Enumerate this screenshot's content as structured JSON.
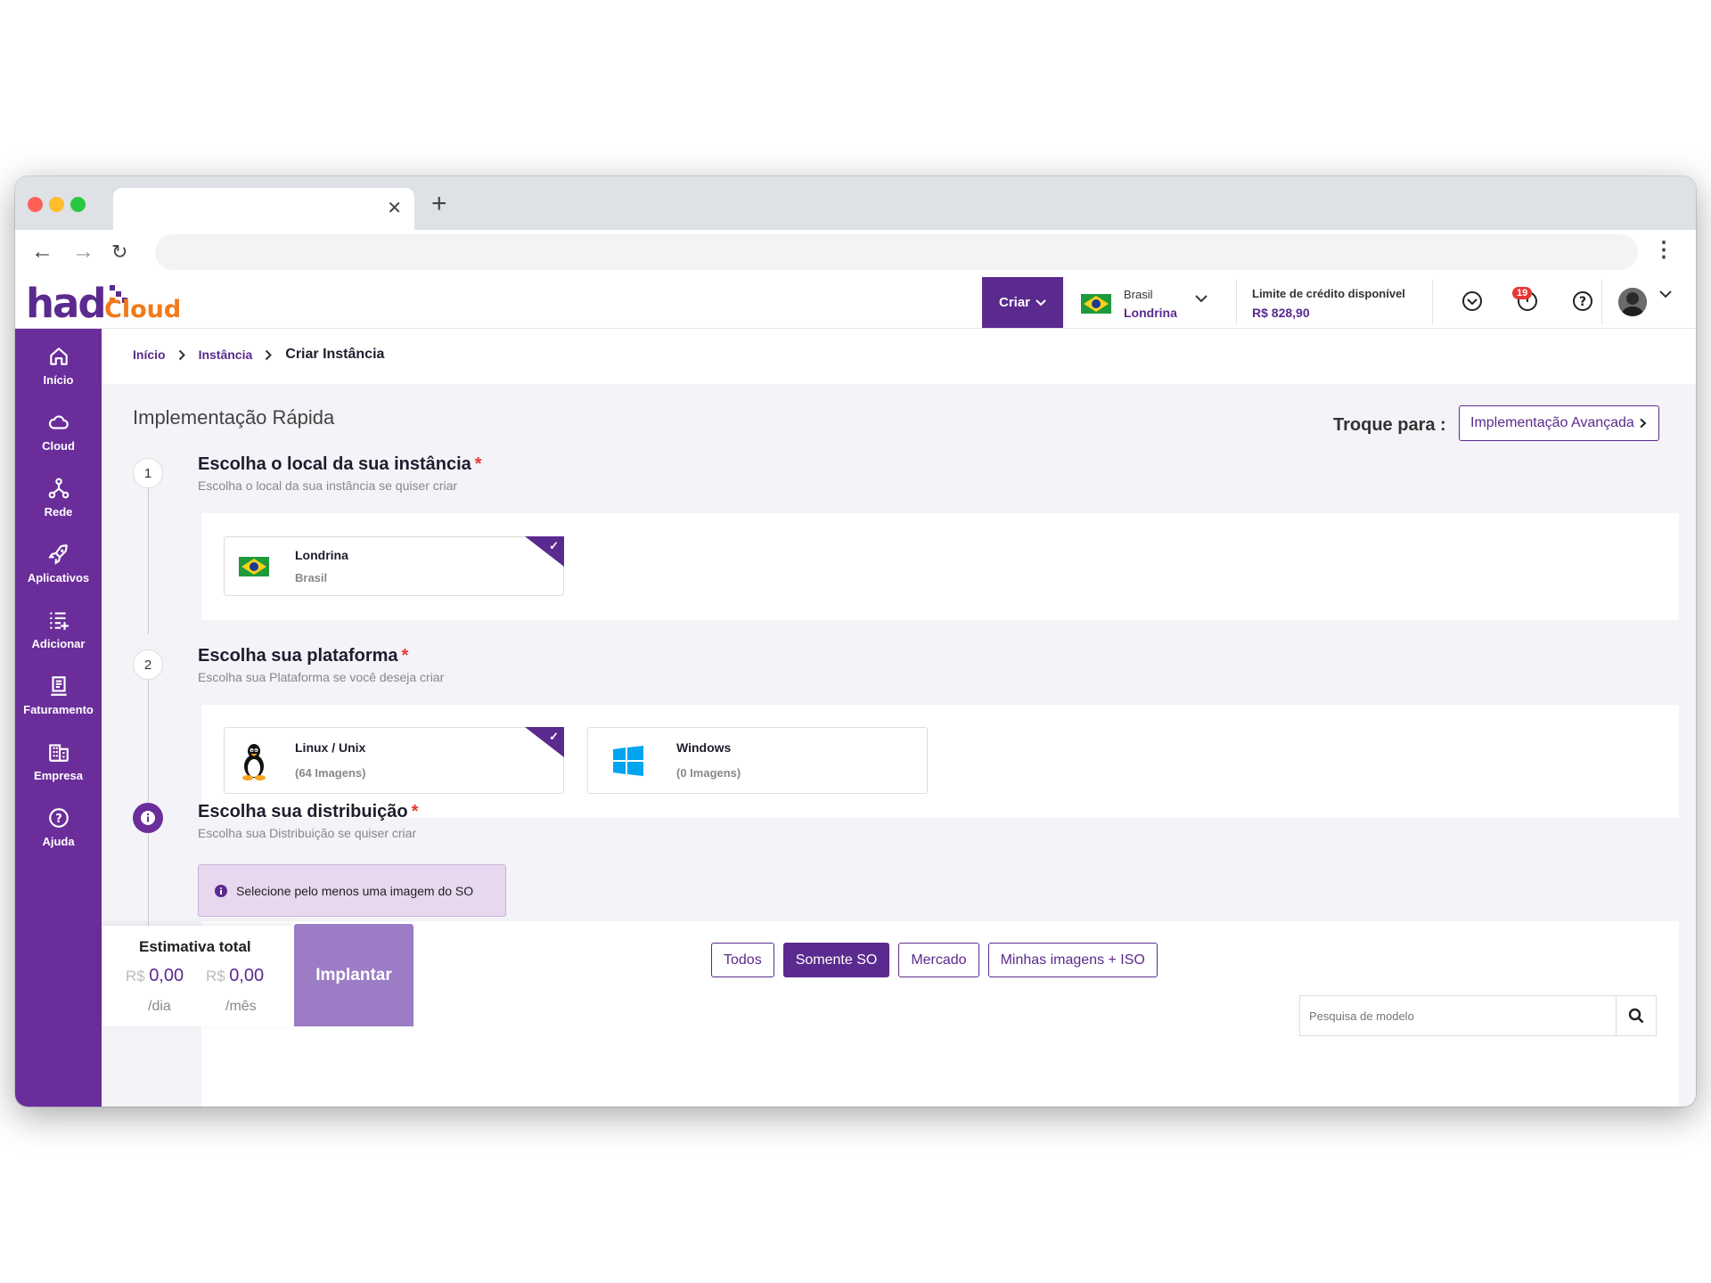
{
  "browser": {
    "tab_title": "",
    "url": ""
  },
  "header": {
    "logo_primary": "had",
    "logo_secondary": "Cloud",
    "create_label": "Criar",
    "region": {
      "country": "Brasil",
      "city": "Londrina"
    },
    "credit": {
      "label": "Limite de crédito disponível",
      "value": "R$ 828,90"
    },
    "notifications_count": "19"
  },
  "sidebar": {
    "items": [
      {
        "label": "Início",
        "icon": "home-icon"
      },
      {
        "label": "Cloud",
        "icon": "cloud-icon"
      },
      {
        "label": "Rede",
        "icon": "network-icon"
      },
      {
        "label": "Aplicativos",
        "icon": "rocket-icon"
      },
      {
        "label": "Adicionar",
        "icon": "add-list-icon"
      },
      {
        "label": "Faturamento",
        "icon": "invoice-icon"
      },
      {
        "label": "Empresa",
        "icon": "building-icon"
      },
      {
        "label": "Ajuda",
        "icon": "help-icon"
      }
    ]
  },
  "breadcrumb": {
    "items": [
      "Início",
      "Instância"
    ],
    "current": "Criar Instância"
  },
  "page": {
    "title": "Implementação Rápida",
    "switch_label": "Troque para :",
    "switch_button": "Implementação Avançada"
  },
  "steps": [
    {
      "number": "1",
      "title": "Escolha o local da sua instância",
      "subtitle": "Escolha o local da sua instância se quiser criar",
      "options": [
        {
          "title": "Londrina",
          "subtitle": "Brasil",
          "selected": true
        }
      ]
    },
    {
      "number": "2",
      "title": "Escolha sua plataforma",
      "subtitle": "Escolha sua Plataforma se você deseja criar",
      "options": [
        {
          "title": "Linux / Unix",
          "subtitle": "(64 Imagens)",
          "selected": true
        },
        {
          "title": "Windows",
          "subtitle": "(0 Imagens)",
          "selected": false
        }
      ]
    },
    {
      "title": "Escolha sua distribuição",
      "subtitle": "Escolha sua Distribuição se quiser criar",
      "alert": "Selecione pelo menos uma imagem do SO"
    }
  ],
  "filters": {
    "tabs": [
      "Todos",
      "Somente SO",
      "Mercado",
      "Minhas imagens + ISO"
    ],
    "active": "Somente SO"
  },
  "search": {
    "placeholder": "Pesquisa de modelo"
  },
  "estimate": {
    "title": "Estimativa total",
    "currency": "R$",
    "daily": "0,00",
    "monthly": "0,00",
    "daily_unit": "/dia",
    "monthly_unit": "/mês",
    "deploy_label": "Implantar"
  },
  "colors": {
    "brand_purple": "#5b2a8e",
    "sidebar_purple": "#6a2d9a",
    "logo_orange": "#f27a1a",
    "required_red": "#e53935"
  }
}
